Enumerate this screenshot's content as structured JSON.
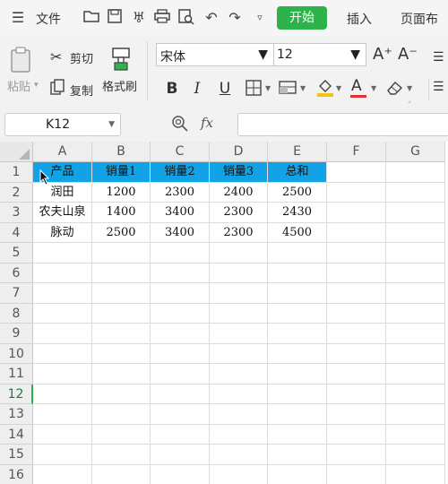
{
  "menubar": {
    "file_label": "文件",
    "tabs": [
      {
        "label": "开始",
        "active": true
      },
      {
        "label": "插入"
      },
      {
        "label": "页面布"
      }
    ],
    "accent": "#2eb34a"
  },
  "ribbon": {
    "cut_label": "剪切",
    "paste_label": "粘贴",
    "copy_label": "复制",
    "format_painter_label": "格式刷",
    "font_name": "宋体",
    "font_size": "12",
    "bold": "B",
    "italic": "I",
    "underline": "U",
    "grow_font": "A⁺",
    "shrink_font": "A⁻"
  },
  "formula_bar": {
    "cell_ref": "K12",
    "fx_label": "fx",
    "content": ""
  },
  "sheet": {
    "columns": [
      "A",
      "B",
      "C",
      "D",
      "E",
      "F",
      "G"
    ],
    "rows": [
      "1",
      "2",
      "3",
      "4",
      "5",
      "6",
      "7",
      "8",
      "9",
      "10",
      "11",
      "12",
      "13",
      "14",
      "15",
      "16"
    ],
    "active_row": "12",
    "header_fill": "#12a3e6",
    "data": [
      [
        "产品",
        "销量1",
        "销量2",
        "销量3",
        "总和"
      ],
      [
        "润田",
        "1200",
        "2300",
        "2400",
        "2500"
      ],
      [
        "农夫山泉",
        "1400",
        "3400",
        "2300",
        "2430"
      ],
      [
        "脉动",
        "2500",
        "3400",
        "2300",
        "4500"
      ]
    ]
  }
}
